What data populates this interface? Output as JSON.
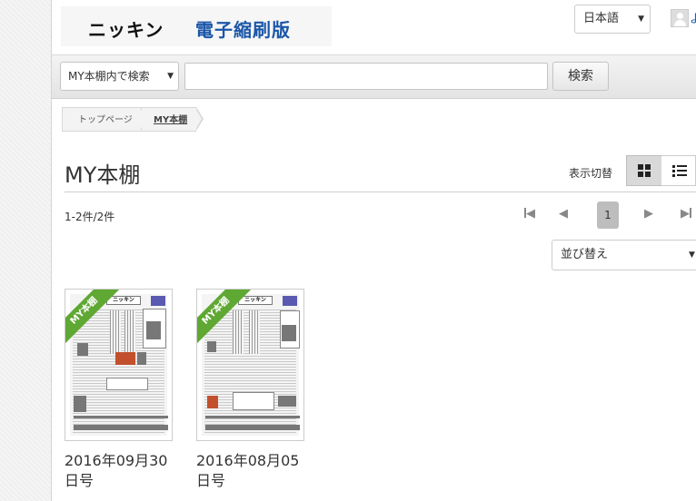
{
  "header": {
    "logo_part1": "ニッキン",
    "logo_part2": "電子縮刷版",
    "language": "日本語",
    "user_text": "よ"
  },
  "search": {
    "scope": "MY本棚内で検索",
    "query": "",
    "button": "検索"
  },
  "breadcrumb": [
    {
      "label": "トップページ"
    },
    {
      "label": "MY本棚"
    }
  ],
  "main": {
    "title": "MY本棚",
    "view_toggle_label": "表示切替",
    "result_count": "1-2件/2件",
    "current_page": "1",
    "sort_label": "並び替え"
  },
  "books": [
    {
      "ribbon": "MY本棚",
      "date_line1": "2016年09月30",
      "date_line2": "日号",
      "masthead": "ニッキン"
    },
    {
      "ribbon": "MY本棚",
      "date_line1": "2016年08月05",
      "date_line2": "日号",
      "masthead": "ニッキン"
    }
  ],
  "icons": {
    "grid_view": "grid-icon",
    "list_view": "list-icon",
    "first_page": "first-page-icon",
    "prev_page": "prev-page-icon",
    "next_page": "next-page-icon",
    "last_page": "last-page-icon",
    "user": "user-icon"
  },
  "colors": {
    "ribbon": "#5fa833",
    "logo_accent": "#1a56a8"
  }
}
